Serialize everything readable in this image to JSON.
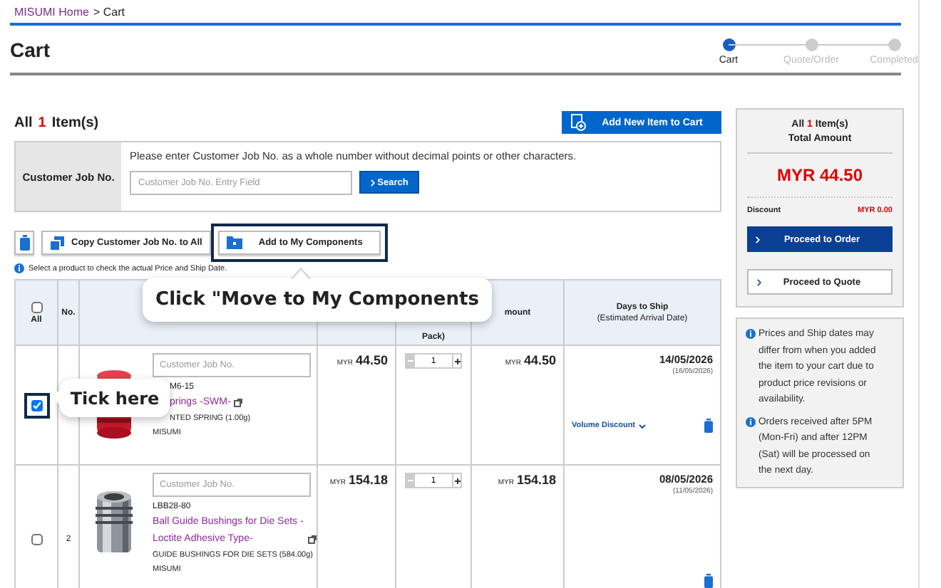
{
  "breadcrumb": [
    {
      "label": "MISUMI Home",
      "link": true
    },
    {
      "label": "> Cart",
      "link": false
    }
  ],
  "page_title": "Cart",
  "steps": [
    {
      "label": "Cart",
      "selected": true
    },
    {
      "label": "Quote/Order",
      "selected": false
    },
    {
      "label": "Completed",
      "selected": false
    }
  ],
  "item_count": {
    "prefix": "All",
    "count": "1",
    "suffix": "Item(s)"
  },
  "add_item_button": "Add New Item to Cart",
  "job_no": {
    "label": "Customer Job No.",
    "hint": "Please enter Customer Job No. as a whole number without decimal points or other characters.",
    "placeholder": "Customer Job No. Entry Field",
    "button": "Search"
  },
  "toolbar": [
    {
      "kind": "delete",
      "highlighted": false
    },
    {
      "kind": "copy",
      "label": "Copy Customer Job No. to All",
      "highlighted": false
    },
    {
      "kind": "components",
      "label": "Add to My Components",
      "highlighted": true
    }
  ],
  "note": "Select a product to check the actual Price and Ship Date.",
  "table": {
    "select_all": {
      "label": "All",
      "checked": false
    },
    "no_header": "No.",
    "qty_header": "Pack)",
    "amount_header": "mount",
    "days_header": {
      "title": "Days to Ship",
      "subtitle": "(Estimated Arrival Date)"
    }
  },
  "rows": [
    {
      "checked": true,
      "highlighted": true,
      "image": {
        "kind": "spring"
      },
      "job_placeholder": "Customer Job No.",
      "part_no": "M6-15",
      "name": "prings -SWM-",
      "description": "NTED SPRING (1.00g)",
      "maker": "MISUMI",
      "currency": "MYR",
      "unit_price": "44.50",
      "qty": "1",
      "amount_currency": "MYR",
      "amount": "44.50",
      "ship_date": "14/05/2026",
      "arrival": "(16/05/2026)",
      "volume_discount": "Volume Discount"
    },
    {
      "checked": false,
      "highlighted": false,
      "number": "2",
      "image": {
        "kind": "bushing"
      },
      "job_placeholder": "Customer Job No.",
      "part_no": "LBB28-80",
      "name": "Ball Guide Bushings for Die Sets -Loctite Adhesive Type-",
      "description": "GUIDE BUSHINGS FOR DIE SETS (584.00g)",
      "maker": "MISUMI",
      "currency": "MYR",
      "unit_price": "154.18",
      "qty": "1",
      "amount_currency": "MYR",
      "amount": "154.18",
      "ship_date": "08/05/2026",
      "arrival": "(11/05/2026)"
    }
  ],
  "summary": {
    "prefix": "All",
    "count": "1",
    "suffix": "Item(s)",
    "title": "Total Amount",
    "total": "MYR 44.50",
    "discount_label": "Discount",
    "discount": "MYR 0.00",
    "order_button": "Proceed to Order",
    "quote_button": "Proceed to Quote"
  },
  "notices": [
    "Prices and Ship dates may differ from when you added the item to your cart due to product price revisions or availability.",
    "Orders received after 5PM (Mon-Fri) and after 12PM (Sat) will be processed on the next day."
  ],
  "callouts": [
    {
      "kind": "toolbar",
      "text": "Click \"Move to My Components"
    },
    {
      "kind": "checkbox",
      "text": "Tick here"
    }
  ]
}
